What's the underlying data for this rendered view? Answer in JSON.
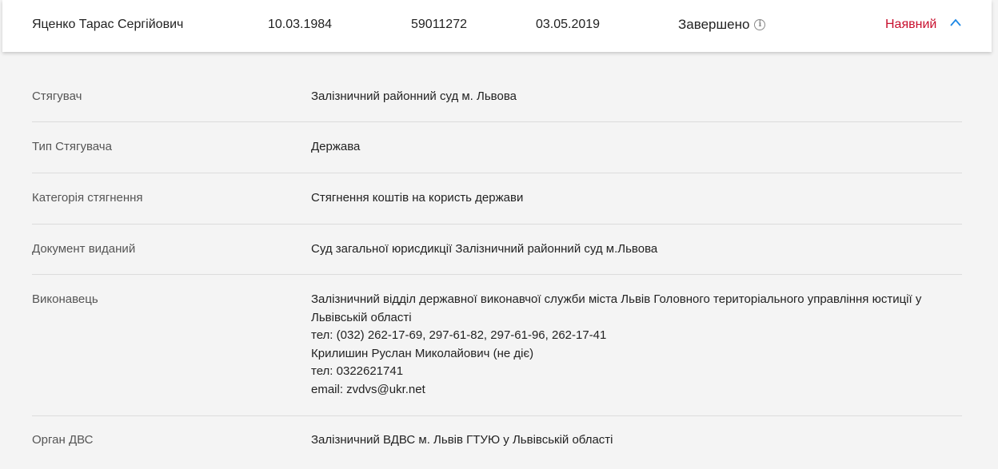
{
  "record": {
    "name": "Яценко Тарас Сергійович",
    "birth_date": "10.03.1984",
    "case_number": "59011272",
    "open_date": "03.05.2019",
    "status": "Завершено",
    "availability": "Наявний"
  },
  "icons": {
    "status_info": "info-icon",
    "toggle": "chevron-up-icon"
  },
  "colors": {
    "availability": "#c8102e",
    "chevron": "#1e88e5"
  },
  "details": [
    {
      "label": "Стягувач",
      "lines": [
        "Залізничний районний суд м. Львова"
      ]
    },
    {
      "label": "Тип Стягувача",
      "lines": [
        "Держава"
      ]
    },
    {
      "label": "Категорія стягнення",
      "lines": [
        "Стягнення коштів на користь держави"
      ]
    },
    {
      "label": "Документ виданий",
      "lines": [
        "Суд загальної юрисдикції Залізничний районний суд м.Львова"
      ]
    },
    {
      "label": "Виконавець",
      "lines": [
        "Залізничний відділ державної виконавчої служби міста Львів Головного територіального управління юстиції у Львівській області",
        "тел: (032) 262-17-69, 297-61-82, 297-61-96, 262-17-41",
        "Крилишин Руслан Миколайович (не діє)",
        "тел: 0322621741",
        "email: zvdvs@ukr.net"
      ]
    },
    {
      "label": "Орган ДВС",
      "lines": [
        "Залізничний ВДВС м. Львів ГТУЮ у Львівській області"
      ]
    }
  ]
}
